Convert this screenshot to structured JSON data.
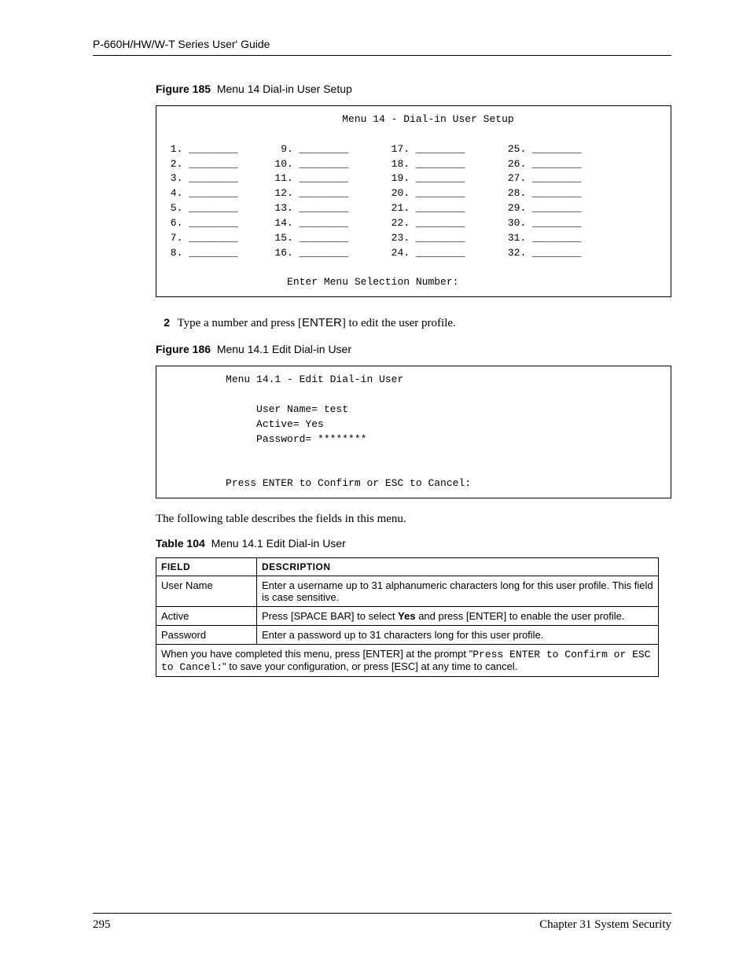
{
  "header": "P-660H/HW/W-T Series User' Guide",
  "fig185": {
    "label": "Figure 185",
    "title": "Menu 14 Dial-in User Setup",
    "box_header_indent": "                             ",
    "box_header": "Menu 14 - Dial-in User Setup",
    "rows": [
      [
        " 1. ________       9. ________       17. ________       25. ________"
      ],
      [
        " 2. ________      10. ________       18. ________       26. ________"
      ],
      [
        " 3. ________      11. ________       19. ________       27. ________"
      ],
      [
        " 4. ________      12. ________       20. ________       28. ________"
      ],
      [
        " 5. ________      13. ________       21. ________       29. ________"
      ],
      [
        " 6. ________      14. ________       22. ________       30. ________"
      ],
      [
        " 7. ________      15. ________       23. ________       31. ________"
      ],
      [
        " 8. ________      16. ________       24. ________       32. ________"
      ]
    ],
    "prompt_indent": "                    ",
    "prompt": "Enter Menu Selection Number:"
  },
  "step2": {
    "num": "2",
    "text_before": "Type a number and press [",
    "enter": "ENTER",
    "text_after": "] to edit the user profile."
  },
  "fig186": {
    "label": "Figure 186",
    "title": "Menu 14.1 Edit Dial-in User",
    "lines": [
      "          Menu 14.1 - Edit Dial-in User",
      "",
      "               User Name= test",
      "               Active= Yes",
      "               Password= ********",
      "",
      "",
      "          Press ENTER to Confirm or ESC to Cancel:"
    ]
  },
  "para": "The following table describes the fields in this menu.",
  "table104": {
    "label": "Table 104",
    "title": "Menu 14.1 Edit Dial-in User",
    "head_field": "FIELD",
    "head_desc": "DESCRIPTION",
    "rows": [
      {
        "field": "User Name",
        "desc": "Enter a username up to 31 alphanumeric characters long for this user profile. This field is case sensitive."
      },
      {
        "field": "Active",
        "desc_pre": "Press [SPACE BAR] to select ",
        "bold": "Yes",
        "desc_post": " and press [ENTER] to enable the user profile."
      },
      {
        "field": "Password",
        "desc": "Enter a password up to 31 characters long for this user profile."
      }
    ],
    "footer_pre": "When you have completed this menu, press [ENTER] at the prompt \"",
    "footer_mono": "Press ENTER to Confirm or ESC to Cancel:",
    "footer_post": "\" to save your configuration, or press [ESC] at any time to cancel."
  },
  "footer": {
    "page": "295",
    "chapter": "Chapter 31 System Security"
  }
}
